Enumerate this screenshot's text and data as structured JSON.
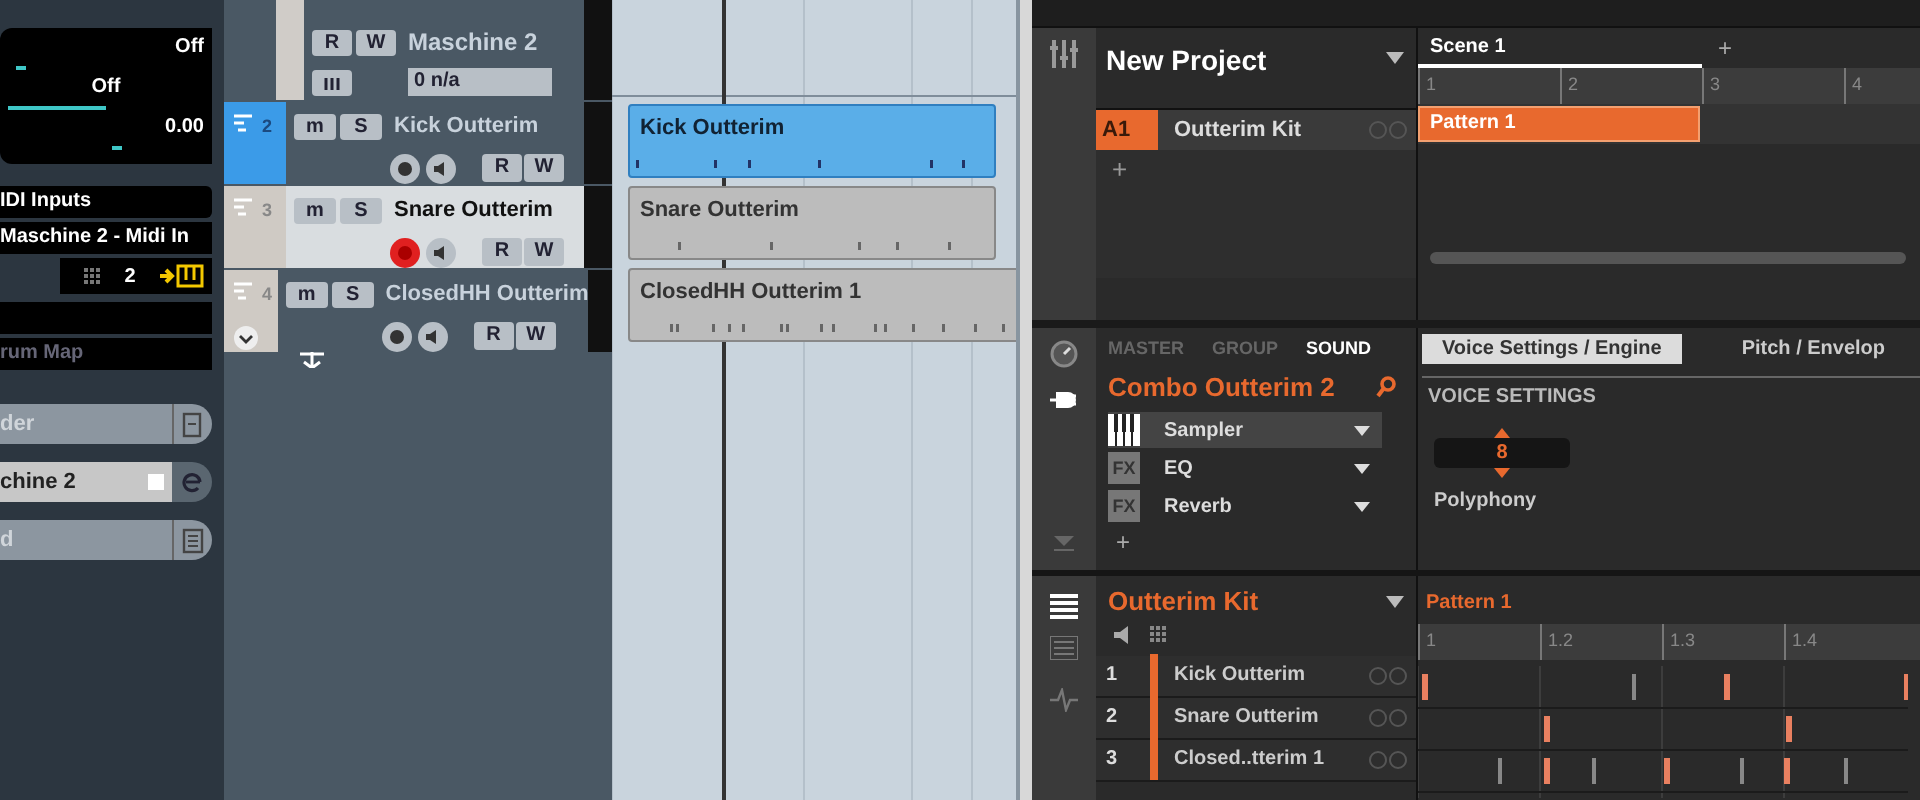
{
  "inspector": {
    "sliders": [
      {
        "kind": "thumb",
        "value": "Off",
        "level": 0.04
      },
      {
        "kind": "fill",
        "value": "Off",
        "level": 0.5
      },
      {
        "kind": "thumb",
        "value": "0.00",
        "level": 0.53
      }
    ],
    "midi": {
      "label": "IDI Inputs",
      "device": "Maschine 2 - Midi In",
      "channel": "2",
      "map": "rum Map"
    },
    "buttons": [
      {
        "label": "der",
        "kind": "frame",
        "selected": false
      },
      {
        "label": "chine 2",
        "kind": "edit",
        "selected": true
      },
      {
        "label": "d",
        "kind": "notes",
        "selected": false
      }
    ]
  },
  "top_track": {
    "name": "Maschine 2",
    "output": "0 n/a",
    "buttons": [
      "R",
      "W"
    ]
  },
  "tracks": [
    {
      "number": "2",
      "name": "Kick Outterim",
      "selected": true,
      "highlighted": false,
      "record": false,
      "expandable": false,
      "buttons": [
        "m",
        "S",
        "R",
        "W"
      ]
    },
    {
      "number": "3",
      "name": "Snare Outterim",
      "selected": false,
      "highlighted": true,
      "record": true,
      "expandable": false,
      "buttons": [
        "m",
        "S",
        "R",
        "W"
      ]
    },
    {
      "number": "4",
      "name": "ClosedHH Outterim",
      "selected": false,
      "highlighted": false,
      "record": false,
      "expandable": true,
      "buttons": [
        "m",
        "S",
        "R",
        "W"
      ]
    }
  ],
  "events": [
    {
      "name": "Kick Outterim",
      "selected": true
    },
    {
      "name": "Snare Outterim",
      "selected": false
    },
    {
      "name": "ClosedHH Outterim 1",
      "selected": false
    }
  ],
  "maschine": {
    "project": "New Project",
    "scenes": [
      {
        "label": "Scene 1",
        "selected": true
      }
    ],
    "add_scene": "+",
    "ruler": [
      "1",
      "2",
      "3",
      "4"
    ],
    "groups": [
      {
        "slot": "A1",
        "name": "Outterim Kit",
        "selected": true
      }
    ],
    "add_group": "+",
    "clips": [
      "Pattern 1"
    ],
    "sound_tabs": [
      {
        "label": "MASTER",
        "selected": false
      },
      {
        "label": "GROUP",
        "selected": false
      },
      {
        "label": "SOUND",
        "selected": true
      }
    ],
    "sound_name": "Combo Outterim 2",
    "modules": [
      {
        "kind": "instrument",
        "name": "Sampler",
        "selected": true
      },
      {
        "kind": "fx",
        "badge": "FX",
        "name": "EQ",
        "selected": false
      },
      {
        "kind": "fx",
        "badge": "FX",
        "name": "Reverb",
        "selected": false
      }
    ],
    "add_module": "+",
    "pages": [
      {
        "label": "Voice Settings / Engine",
        "selected": true
      },
      {
        "label": "Pitch / Envelop",
        "selected": false
      }
    ],
    "section": "VOICE SETTINGS",
    "polyphony": {
      "value": "8",
      "label": "Polyphony"
    },
    "kit": "Outterim Kit",
    "pattern": "Pattern 1",
    "pattern_ruler": [
      "1",
      "1.2",
      "1.3",
      "1.4"
    ],
    "sounds": [
      {
        "number": "1",
        "name": "Kick Outterim"
      },
      {
        "number": "2",
        "name": "Snare Outterim"
      },
      {
        "number": "3",
        "name": "Closed..tterim 1"
      }
    ]
  }
}
